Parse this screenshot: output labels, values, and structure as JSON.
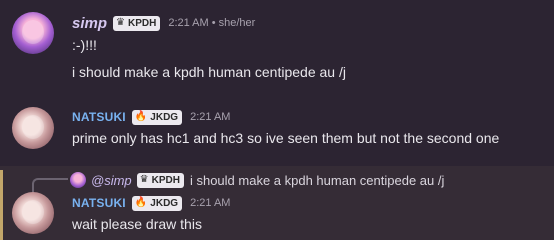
{
  "messages": [
    {
      "author": "simp",
      "tag": "KPDH",
      "tag_icon": "crown-icon",
      "time": "2:21 AM",
      "pronouns": "• she/her",
      "lines": [
        ":-)!!!",
        "i should make a kpdh human centipede au /j"
      ]
    },
    {
      "author": "NATSUKI",
      "tag": "JKDG",
      "tag_icon": "fire-icon",
      "time": "2:21 AM",
      "lines": [
        "prime only has hc1 and hc3 so ive seen them but not the second one"
      ]
    },
    {
      "reply": {
        "author": "@simp",
        "tag": "KPDH",
        "text": "i should make a kpdh human centipede au /j"
      },
      "author": "NATSUKI",
      "tag": "JKDG",
      "tag_icon": "fire-icon",
      "time": "2:21 AM",
      "lines": [
        "wait please draw this"
      ]
    }
  ],
  "colors": {
    "background": "#2c2432",
    "simp_name": "#d6c8f0",
    "natsuki_name": "#79b2f0",
    "reply_accent": "#c2a66a"
  }
}
